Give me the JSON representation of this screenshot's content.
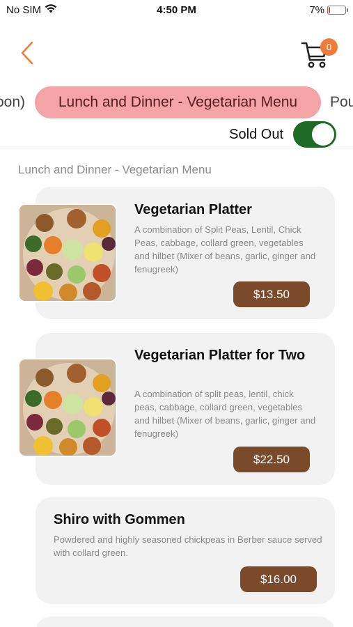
{
  "status_bar": {
    "carrier": "No SIM",
    "time": "4:50 PM",
    "battery": "7%",
    "battery_level": 0.07
  },
  "header": {
    "cart_count": "0",
    "icons": {
      "back": "chevron-left-icon",
      "cart": "cart-icon"
    },
    "accent_color": "#f07c3a"
  },
  "tabs": {
    "prev_label": "oon)",
    "active_label": "Lunch and Dinner - Vegetarian Menu",
    "next_label": "Pou",
    "active_color": "#f4a3a7"
  },
  "sold_out": {
    "label": "Sold Out",
    "enabled": true,
    "toggle_color": "#1e6b26"
  },
  "section": {
    "title": "Lunch and Dinner - Vegetarian Menu"
  },
  "items": [
    {
      "name": "Vegetarian Platter",
      "description": "A combination of Split Peas, Lentil, Chick Peas, cabbage, collard green, vegetables and hilbet (Mixer of beans, garlic, ginger and fenugreek)",
      "price": "$13.50"
    },
    {
      "name": "Vegetarian Platter for Two",
      "description": "A combination of split peas, lentil, chick peas, cabbage, collard green, vegetables and hilbet (Mixer of beans, garlic, ginger and fenugreek)",
      "price": "$22.50"
    },
    {
      "name": "Shiro with Gommen",
      "description": "Powdered and highly seasoned chickpeas in Berber sauce served with collard green.",
      "price": "$16.00"
    }
  ],
  "price_button_color": "#7a4a2a"
}
